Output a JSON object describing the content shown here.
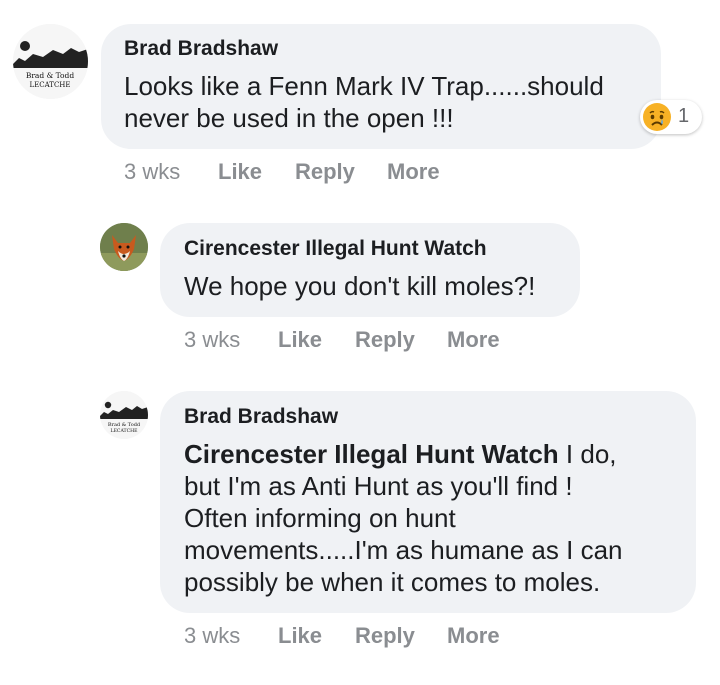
{
  "comments": [
    {
      "author": "Brad Bradshaw",
      "avatar_icon": "molecatcher-logo",
      "avatar_text": [
        "Brad & Todd",
        "LECATCHE"
      ],
      "text_lines": [
        "Looks like a Fenn Mark IV Trap......should",
        "never be used in the open !!!"
      ],
      "reaction": {
        "icon": "sad-face-reaction-icon",
        "count": "1"
      },
      "time": "3 wks",
      "like": "Like",
      "reply": "Reply",
      "more": "More"
    },
    {
      "author": "Cirencester Illegal Hunt Watch",
      "avatar_icon": "fox-photo",
      "text_lines": [
        "We hope you don't kill moles?!"
      ],
      "time": "3 wks",
      "like": "Like",
      "reply": "Reply",
      "more": "More"
    },
    {
      "author": "Brad Bradshaw",
      "avatar_icon": "molecatcher-logo",
      "avatar_text": [
        "Brad & Todd",
        "LECATCHE"
      ],
      "mention": "Cirencester Illegal Hunt Watch",
      "text_first": " I do,",
      "text_lines": [
        "but I'm as Anti Hunt as you'll find !",
        "Often informing on hunt",
        "movements.....I'm as humane as I can",
        "possibly be when it comes to moles."
      ],
      "time": "3 wks",
      "like": "Like",
      "reply": "Reply",
      "more": "More"
    }
  ],
  "colors": {
    "bubble": "#f0f2f5",
    "meta_text": "#8a8d91",
    "text": "#1c1e21"
  }
}
